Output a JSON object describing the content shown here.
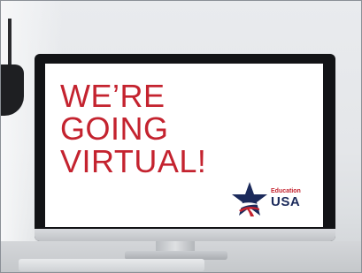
{
  "screen": {
    "headline_lines": [
      "WE’RE",
      "GOING",
      "VIRTUAL!"
    ]
  },
  "logo": {
    "small_text": "Education",
    "big_text": "USA",
    "icon": "star-icon"
  },
  "colors": {
    "headline": "#c4232f",
    "logo_navy": "#1b2a5b",
    "logo_red": "#c4232f",
    "background": "#e4e6e9"
  }
}
